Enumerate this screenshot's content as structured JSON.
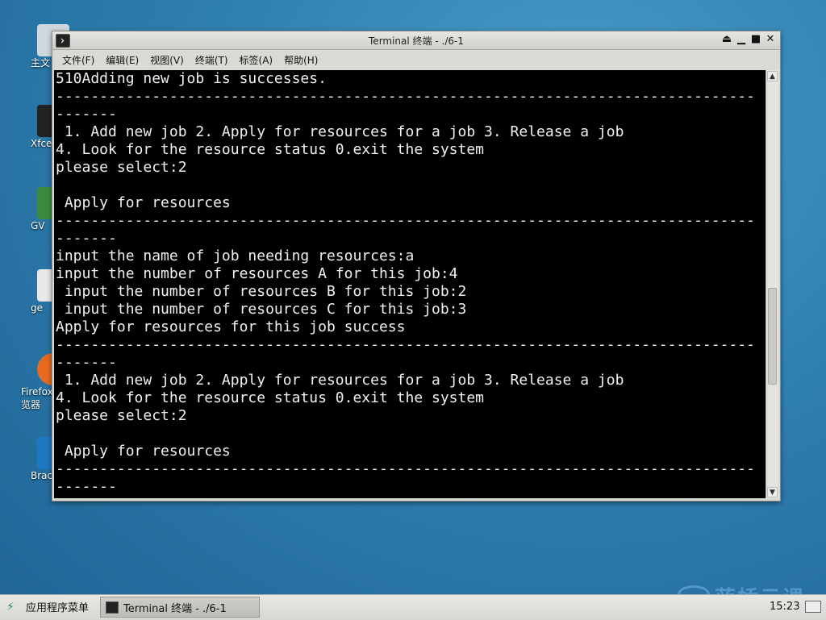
{
  "desktop": {
    "icons": [
      {
        "label": "主文",
        "icon": "home-folder-icon"
      },
      {
        "label": "Xfce",
        "icon": "terminal-icon"
      },
      {
        "label": "GV",
        "icon": "editor-icon"
      },
      {
        "label": "ge",
        "icon": "document-icon"
      },
      {
        "label": "Firefox\n览器",
        "icon": "firefox-icon"
      },
      {
        "label": "Brac",
        "icon": "brackets-icon"
      }
    ]
  },
  "window": {
    "title": "Terminal 终端 - ./6-1",
    "buttons": {
      "shade": "⏏",
      "minimize": "▁",
      "maximize": "■",
      "close": "✕"
    }
  },
  "menubar": {
    "items": [
      "文件(F)",
      "编辑(E)",
      "视图(V)",
      "终端(T)",
      "标签(A)",
      "帮助(H)"
    ]
  },
  "terminal": {
    "lines": [
      "510Adding new job is successes.",
      "--------------------------------------------------------------------------------",
      "-------",
      " 1. Add new job 2. Apply for resources for a job 3. Release a job",
      "4. Look for the resource status 0.exit the system",
      "please select:2",
      "",
      " Apply for resources",
      "--------------------------------------------------------------------------------",
      "-------",
      "input the name of job needing resources:a",
      "input the number of resources A for this job:4",
      " input the number of resources B for this job:2",
      " input the number of resources C for this job:3",
      "Apply for resources for this job success",
      "--------------------------------------------------------------------------------",
      "-------",
      " 1. Add new job 2. Apply for resources for a job 3. Release a job",
      "4. Look for the resource status 0.exit the system",
      "please select:2",
      "",
      " Apply for resources",
      "--------------------------------------------------------------------------------",
      "-------"
    ]
  },
  "taskbar": {
    "apps_menu": "应用程序菜单",
    "task_label": "Terminal 终端 - ./6-1",
    "clock": "15:23",
    "watermark": "蓝桥云课"
  },
  "colors": {
    "desktop": "#2f7fb0",
    "terminal_bg": "#000000",
    "terminal_fg": "#f0f0f0"
  }
}
